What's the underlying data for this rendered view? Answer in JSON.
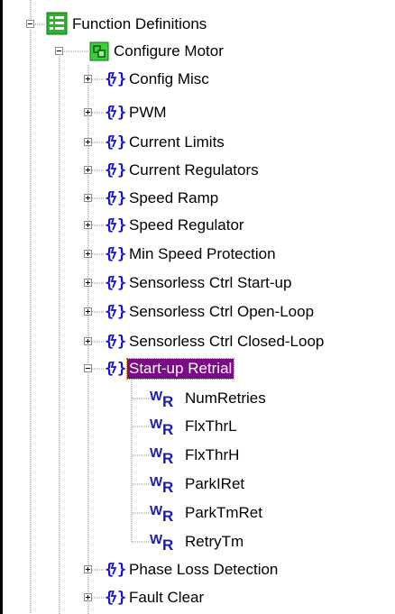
{
  "tree": {
    "root": {
      "label": "Function Definitions",
      "icon": "function-definitions-icon"
    },
    "configure_motor": {
      "label": "Configure Motor",
      "icon": "configure-motor-icon"
    },
    "groups": [
      {
        "label": "Config Misc",
        "icon": "function-group-icon",
        "expanded": false
      },
      {
        "label": "PWM",
        "icon": "function-group-icon",
        "expanded": false
      },
      {
        "label": "Current Limits",
        "icon": "function-group-icon",
        "expanded": false
      },
      {
        "label": "Current Regulators",
        "icon": "function-group-icon",
        "expanded": false
      },
      {
        "label": "Speed Ramp",
        "icon": "function-group-icon",
        "expanded": false
      },
      {
        "label": "Speed Regulator",
        "icon": "function-group-icon",
        "expanded": false
      },
      {
        "label": "Min Speed Protection",
        "icon": "function-group-icon",
        "expanded": false
      },
      {
        "label": "Sensorless Ctrl Start-up",
        "icon": "function-group-icon",
        "expanded": false
      },
      {
        "label": "Sensorless Ctrl Open-Loop",
        "icon": "function-group-icon",
        "expanded": false
      },
      {
        "label": "Sensorless Ctrl Closed-Loop",
        "icon": "function-group-icon",
        "expanded": false
      },
      {
        "label": "Start-up Retrial",
        "icon": "function-group-icon",
        "expanded": true,
        "selected": true
      },
      {
        "label": "Phase Loss Detection",
        "icon": "function-group-icon",
        "expanded": false
      },
      {
        "label": "Fault Clear",
        "icon": "function-group-icon",
        "expanded": false
      }
    ],
    "startup_retrial_params": [
      {
        "label": "NumRetries",
        "icon": "write-register-icon"
      },
      {
        "label": "FlxThrL",
        "icon": "write-register-icon"
      },
      {
        "label": "FlxThrH",
        "icon": "write-register-icon"
      },
      {
        "label": "ParkIRet",
        "icon": "write-register-icon"
      },
      {
        "label": "ParkTmRet",
        "icon": "write-register-icon"
      },
      {
        "label": "RetryTm",
        "icon": "write-register-icon"
      }
    ]
  },
  "colors": {
    "selection_bg": "#7b0a86",
    "selection_text": "#ffffff",
    "group_icon": "#1515c8",
    "register_icon": "#1a1ab4",
    "tree_line": "#8c8c8c",
    "folder_green": "#2bb52b"
  }
}
